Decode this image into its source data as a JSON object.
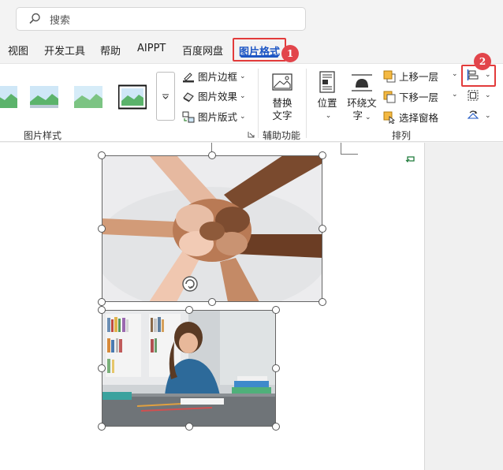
{
  "search": {
    "placeholder": "搜索"
  },
  "tabs": [
    {
      "label": "视图"
    },
    {
      "label": "开发工具"
    },
    {
      "label": "帮助"
    },
    {
      "label": "AIPPT"
    },
    {
      "label": "百度网盘"
    },
    {
      "label": "图片格式",
      "active": true
    }
  ],
  "badges": {
    "step1": "1",
    "step2": "2"
  },
  "ribbon": {
    "picture_styles": {
      "group_label": "图片样式",
      "border": "图片边框",
      "effects": "图片效果",
      "layout": "图片版式"
    },
    "accessibility": {
      "group_label": "辅助功能",
      "alt_text_line1": "替换",
      "alt_text_line2": "文字"
    },
    "arrange": {
      "group_label": "排列",
      "position": "位置",
      "wrap_text_line1": "环绕文",
      "wrap_text_line2": "字",
      "bring_forward": "上移一层",
      "send_backward": "下移一层",
      "selection_pane": "选择窗格"
    }
  },
  "colors": {
    "accent_blue": "#1d56c4",
    "highlight_red": "#e23b3b",
    "badge_red": "#e2454b"
  }
}
